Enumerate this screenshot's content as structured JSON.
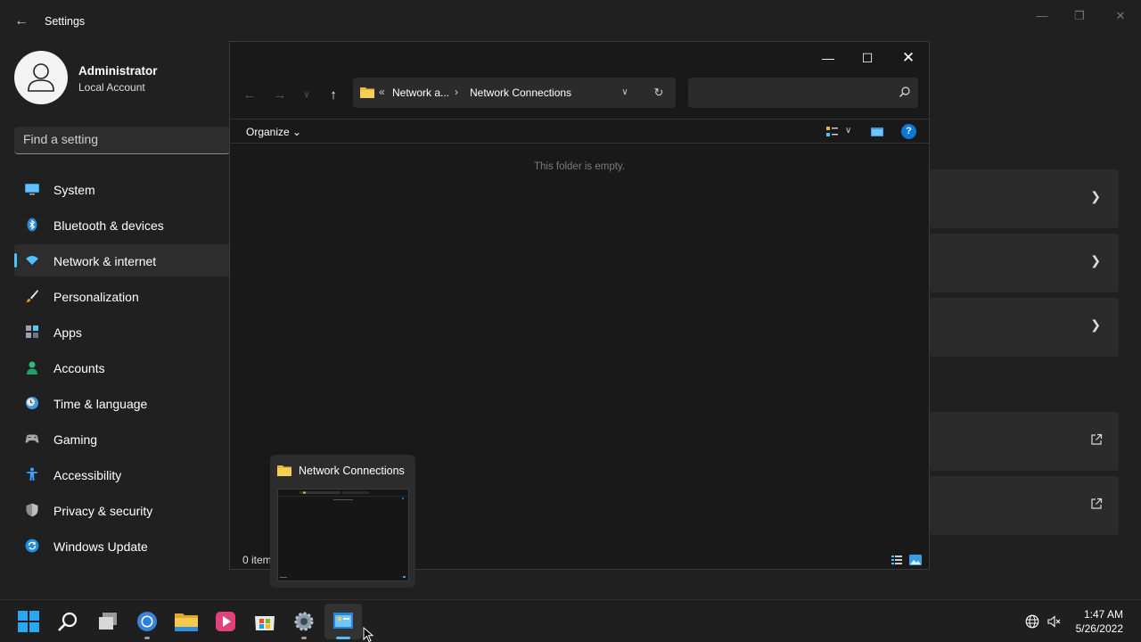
{
  "settings": {
    "title": "Settings",
    "profile": {
      "name": "Administrator",
      "account_type": "Local Account"
    },
    "search_placeholder": "Find a setting",
    "nav": [
      {
        "label": "System",
        "icon": "monitor-icon",
        "active": false
      },
      {
        "label": "Bluetooth & devices",
        "icon": "bluetooth-icon",
        "active": false
      },
      {
        "label": "Network & internet",
        "icon": "wifi-icon",
        "active": true
      },
      {
        "label": "Personalization",
        "icon": "brush-icon",
        "active": false
      },
      {
        "label": "Apps",
        "icon": "apps-icon",
        "active": false
      },
      {
        "label": "Accounts",
        "icon": "person-icon",
        "active": false
      },
      {
        "label": "Time & language",
        "icon": "clock-globe-icon",
        "active": false
      },
      {
        "label": "Gaming",
        "icon": "gamepad-icon",
        "active": false
      },
      {
        "label": "Accessibility",
        "icon": "accessibility-icon",
        "active": false
      },
      {
        "label": "Privacy & security",
        "icon": "shield-icon",
        "active": false
      },
      {
        "label": "Windows Update",
        "icon": "update-icon",
        "active": false
      }
    ]
  },
  "explorer": {
    "breadcrumb": [
      "Network a...",
      "Network Connections"
    ],
    "search_placeholder": "",
    "organize_label": "Organize",
    "empty_message": "This folder is empty.",
    "status_text": "0 items",
    "help_label": "?"
  },
  "thumbnail": {
    "title": "Network Connections"
  },
  "taskbar": {
    "time": "1:47 AM",
    "date": "5/26/2022",
    "apps": [
      "start-icon",
      "search-icon",
      "task-view-icon",
      "chrome-icon",
      "file-explorer-icon",
      "media-player-icon",
      "store-icon",
      "settings-gear-icon",
      "control-panel-icon"
    ]
  },
  "colors": {
    "accent": "#4cc2ff",
    "background": "#202020",
    "window": "#191919",
    "help_blue": "#0a78d4"
  }
}
